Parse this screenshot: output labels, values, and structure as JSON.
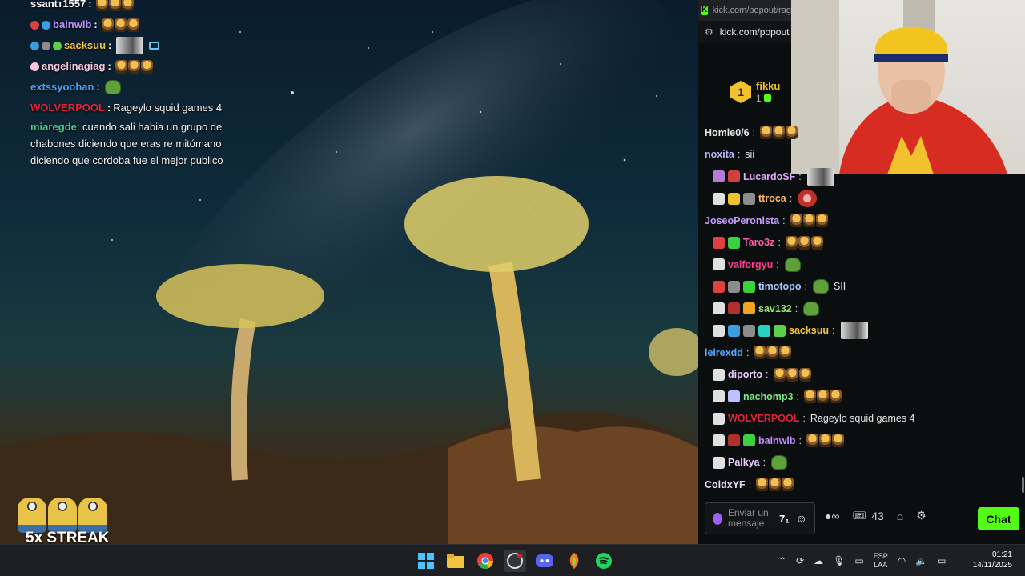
{
  "overlay_chat": [
    {
      "user": "ssantт1557",
      "color": "#ffffff",
      "message": "",
      "emote": "tripleemote"
    },
    {
      "user": "bainwlb",
      "color": "#c090ff",
      "message": "",
      "emote": "tripleemote"
    },
    {
      "user": "sacksuu",
      "color": "#f5c542",
      "message": "",
      "emote": "avatar"
    },
    {
      "user": "angelinagiag",
      "color": "#f6c7d9",
      "message": "",
      "emote": "tripleemote"
    },
    {
      "user": "extssyoohan",
      "color": "#4aa3ff",
      "message": "",
      "emote": "pepe"
    },
    {
      "user": "WOLVERPOOL",
      "color": "#e0253a",
      "message": "Rageylo squid games 4",
      "emote": ""
    }
  ],
  "overlay_long_msg": {
    "user": "miaregde",
    "text": "cuando sali habia un grupo de chabones diciendo que eras re mitómano diciendo que cordoba fue el mejor publico"
  },
  "streak": {
    "label": "5x STREAK"
  },
  "browser": {
    "tab_url": "kick.com/popout/rag",
    "address": "kick.com/popout"
  },
  "top_gifter": {
    "rank": "1",
    "name": "fikku",
    "count": "1"
  },
  "kick_chat": [
    {
      "user": "Homie0/6",
      "color": "#e6e6e6",
      "badges": [],
      "message": "",
      "emote": "tripleemote"
    },
    {
      "user": "noxita",
      "color": "#b9b9ff",
      "badges": [],
      "message": "sii",
      "emote": ""
    },
    {
      "user": "LucardoSF",
      "color": "#e0a8ff",
      "badges": [
        "#b57bd6",
        "#d0413c"
      ],
      "message": "",
      "emote": "avatar"
    },
    {
      "user": "ttroca",
      "color": "#ffb36b",
      "badges": [
        "#e0e0e0",
        "#f2c12e",
        "#8c8c8c"
      ],
      "message": "",
      "emote": "redemote"
    },
    {
      "user": "JoseoPeronista",
      "color": "#c69bff",
      "badges": [],
      "message": "",
      "emote": "tripleemote"
    },
    {
      "user": "Taro3z",
      "color": "#ff5fa0",
      "badges": [
        "#e04040",
        "#3ad13a"
      ],
      "message": "",
      "emote": "tripleemote"
    },
    {
      "user": "valforgyu",
      "color": "#ff3c8c",
      "badges": [
        "#e0e0e0"
      ],
      "message": "",
      "emote": "pepe"
    },
    {
      "user": "timotopo",
      "color": "#a9c7ff",
      "badges": [
        "#e04040",
        "#8c8c8c",
        "#3ad13a"
      ],
      "message": "SII",
      "emote": "pepe"
    },
    {
      "user": "sav132",
      "color": "#9be36b",
      "badges": [
        "#e0e0e0",
        "#b03030",
        "#f2a21e"
      ],
      "message": "",
      "emote": "pepe"
    },
    {
      "user": "sacksuu",
      "color": "#f5c542",
      "badges": [
        "#e0e0e0",
        "#3a9fe0",
        "#8c8c8c",
        "#27d3c0",
        "#5bd14a"
      ],
      "message": "",
      "emote": "avatar"
    },
    {
      "user": "leirexdd",
      "color": "#5aa8ff",
      "badges": [],
      "message": "",
      "emote": "tripleemote"
    },
    {
      "user": "diporto",
      "color": "#f0d0ff",
      "badges": [
        "#e0e0e0"
      ],
      "message": "",
      "emote": "tripleemote"
    },
    {
      "user": "nachomp3",
      "color": "#7ee787",
      "badges": [
        "#e0e0e0",
        "#c0c0ff"
      ],
      "message": "",
      "emote": "tripleemote"
    },
    {
      "user": "WOLVERPOOL",
      "color": "#e0253a",
      "badges": [
        "#e0e0e0"
      ],
      "message": "Rageylo squid games 4",
      "emote": ""
    },
    {
      "user": "bainwlb",
      "color": "#c090ff",
      "badges": [
        "#e0e0e0",
        "#b03030",
        "#3ad13a"
      ],
      "message": "",
      "emote": "tripleemote"
    },
    {
      "user": "Palkya",
      "color": "#f0d0ff",
      "badges": [
        "#e0e0e0"
      ],
      "message": "",
      "emote": "pepe"
    },
    {
      "user": "ColdxYF",
      "color": "#e8d8ff",
      "badges": [],
      "message": "",
      "emote": "tripleemote"
    }
  ],
  "chat_input": {
    "placeholder": "Enviar un mensaje"
  },
  "chat_footer": {
    "count": "43",
    "chat_button": "Chat"
  },
  "taskbar": {
    "apps": [
      "windows-start-icon",
      "file-explorer-icon",
      "chrome-icon",
      "obs-icon",
      "discord-icon",
      "fl-studio-icon",
      "spotify-icon"
    ],
    "lang_top": "ESP",
    "lang_bottom": "LAA",
    "time": "01:21",
    "date": "14/11/2025"
  },
  "colors": {
    "kick_green": "#53fc18",
    "taskbar_bg": "#1d1f23",
    "chat_bg": "#0b0e0f"
  }
}
